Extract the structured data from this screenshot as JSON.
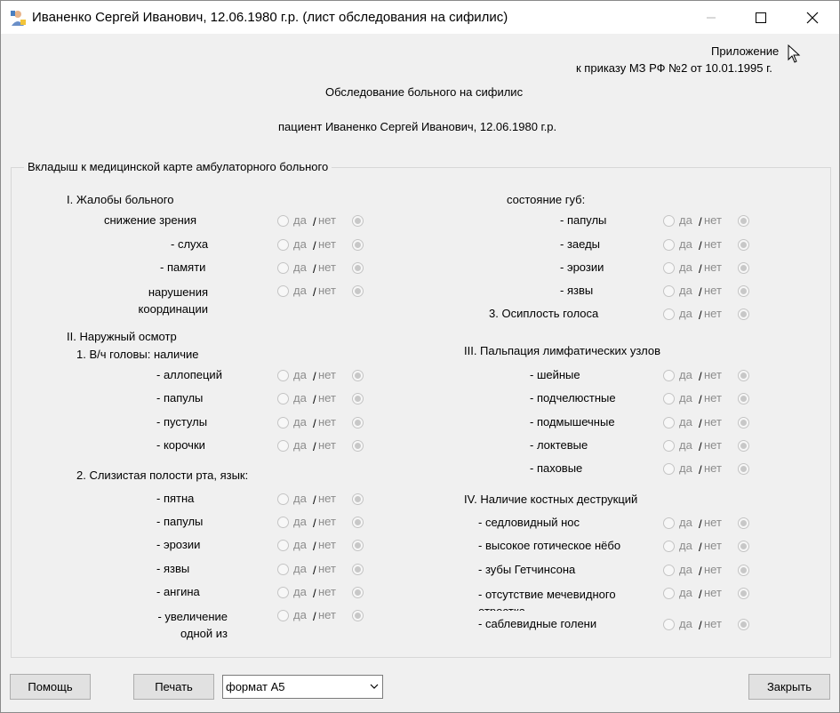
{
  "window": {
    "title": "Иваненко Сергей Иванович, 12.06.1980 г.р. (лист обследования на сифилис)"
  },
  "header": {
    "appendix": "Приложение",
    "order": "к приказу МЗ РФ №2 от 10.01.1995 г.",
    "doc_title": "Обследование больного на сифилис",
    "patient_line": "пациент  Иваненко Сергей Иванович, 12.06.1980 г.р."
  },
  "group_title": "Вкладыш к медицинской карте амбулаторного больного",
  "radio_labels": {
    "yes": "да",
    "no": "нет",
    "slash": "/"
  },
  "left": {
    "s1_title": "I. Жалобы больного",
    "s1_items": [
      "снижение зрения",
      "- слуха",
      "- памяти",
      "нарушения координации"
    ],
    "s2_title": "II. Наружный осмотр",
    "s2_sub1": "1. В/ч головы: наличие",
    "s2_items1": [
      "- аллопеций",
      "- папулы",
      "- пустулы",
      "- корочки"
    ],
    "s2_sub2": "2. Слизистая полости рта, язык:",
    "s2_items2": [
      "- пятна",
      "- папулы",
      "- эрозии",
      "- язвы",
      "- ангина",
      "- увеличение одной из"
    ]
  },
  "right": {
    "lips_title": "состояние губ:",
    "lips_items": [
      "- папулы",
      "- заеды",
      "- эрозии",
      "- язвы"
    ],
    "voice": "3. Осиплость голоса",
    "s3_title": "III. Пальпация лимфатических узлов",
    "s3_items": [
      "- шейные",
      "- подчелюстные",
      "- подмышечные",
      "- локтевые",
      "- паховые"
    ],
    "s4_title": "IV. Наличие костных деструкций",
    "s4_items": [
      "- седловидный нос",
      "- высокое готическое нёбо",
      "- зубы Гетчинсона",
      "- отсутствие мечевидного отростка",
      "- саблевидные голени"
    ]
  },
  "footer": {
    "help": "Помощь",
    "print": "Печать",
    "format": "формат А5",
    "close": "Закрыть"
  }
}
